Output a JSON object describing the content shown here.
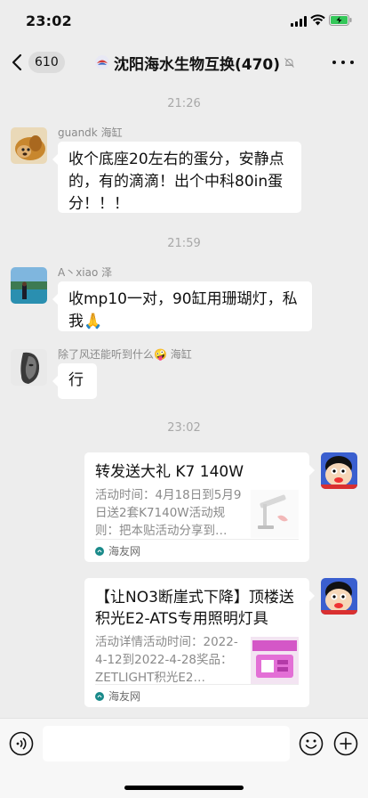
{
  "status_bar": {
    "time": "23:02"
  },
  "nav": {
    "unread_count": "610",
    "title": "沈阳海水生物互换(470)"
  },
  "messages": {
    "ts1": "21:26",
    "m1": {
      "sender": "guandk 海缸",
      "text": "收个底座20左右的蛋分，安静点的，有的滴滴！出个中科80in蛋分！！！"
    },
    "ts2": "21:59",
    "m2": {
      "sender": "A丶xiao 泽",
      "text": "收mp10一对，90缸用珊瑚灯，私我🙏"
    },
    "m3": {
      "sender": "除了风还能听到什么🤪 海缸",
      "text": "行"
    },
    "ts3": "23:02",
    "card1": {
      "title": "转发送大礼 K7 140W",
      "desc": "活动时间：4月18日到5月9日送2套K7140W活动规则：把本贴活动分享到…",
      "source": "海友网"
    },
    "card2": {
      "title": "【让NO3断崖式下降】顶楼送积光E2-ATS专用照明灯具",
      "desc": "活动详情活动时间：2022-4-12到2022-4-28奖品：ZETLIGHT积光E2…",
      "source": "海友网"
    }
  },
  "input": {
    "placeholder": ""
  },
  "colors": {
    "background": "#ededed",
    "bubble": "#ffffff",
    "timestamp": "#a8a8a8",
    "source_icon": "#1a8a8a"
  }
}
